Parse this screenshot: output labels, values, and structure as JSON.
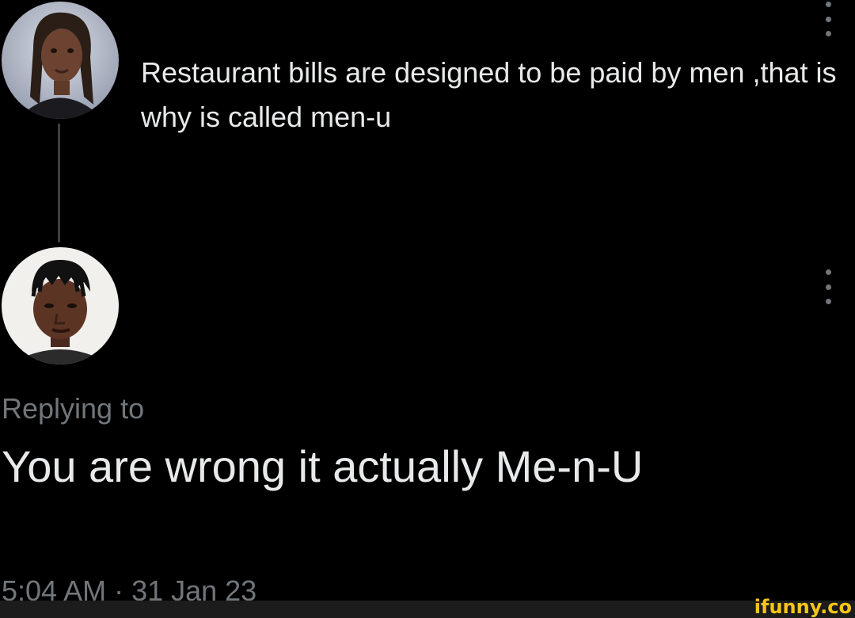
{
  "original_tweet": {
    "text": "Restaurant bills are designed to be paid by men ,that is why is called men-u",
    "avatar_icon": "user-avatar-woman",
    "more_icon": "more-options-icon"
  },
  "reply_tweet": {
    "replying_label": "Replying to",
    "text": "You are wrong it actually Me-n-U",
    "timestamp": "5:04 AM · 31 Jan 23",
    "avatar_icon": "user-avatar-man",
    "more_icon": "more-options-icon"
  },
  "watermark": {
    "text": "ifunny.co",
    "color": "#f5c518"
  },
  "colors": {
    "background": "#000000",
    "primary_text": "#e7e9ea",
    "secondary_text": "#71767b",
    "thread_line": "#3a3f44"
  }
}
